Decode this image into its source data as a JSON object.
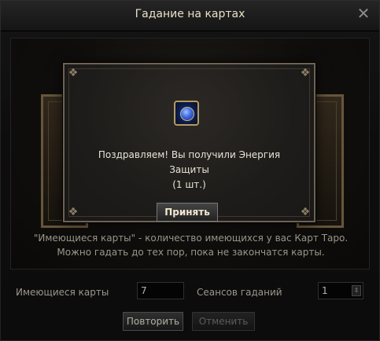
{
  "window": {
    "title": "Гадание на картах",
    "close_glyph": "✕"
  },
  "description": "\"Имеющиеся карты\" - количество имеющихся у вас Карт Таро. Можно гадать до тех пор, пока не закончатся карты.",
  "fields": {
    "available_cards_label": "Имеющиеся карты",
    "available_cards_value": "7",
    "sessions_label": "Сеансов гаданий",
    "sessions_value": "1"
  },
  "buttons": {
    "repeat": "Повторить",
    "cancel": "Отменить"
  },
  "dialog": {
    "icon": "blue-gem-icon",
    "message_line1": "Поздравляем! Вы получили Энергия Защиты",
    "message_line2": "(1 шт.)",
    "accept": "Принять"
  }
}
